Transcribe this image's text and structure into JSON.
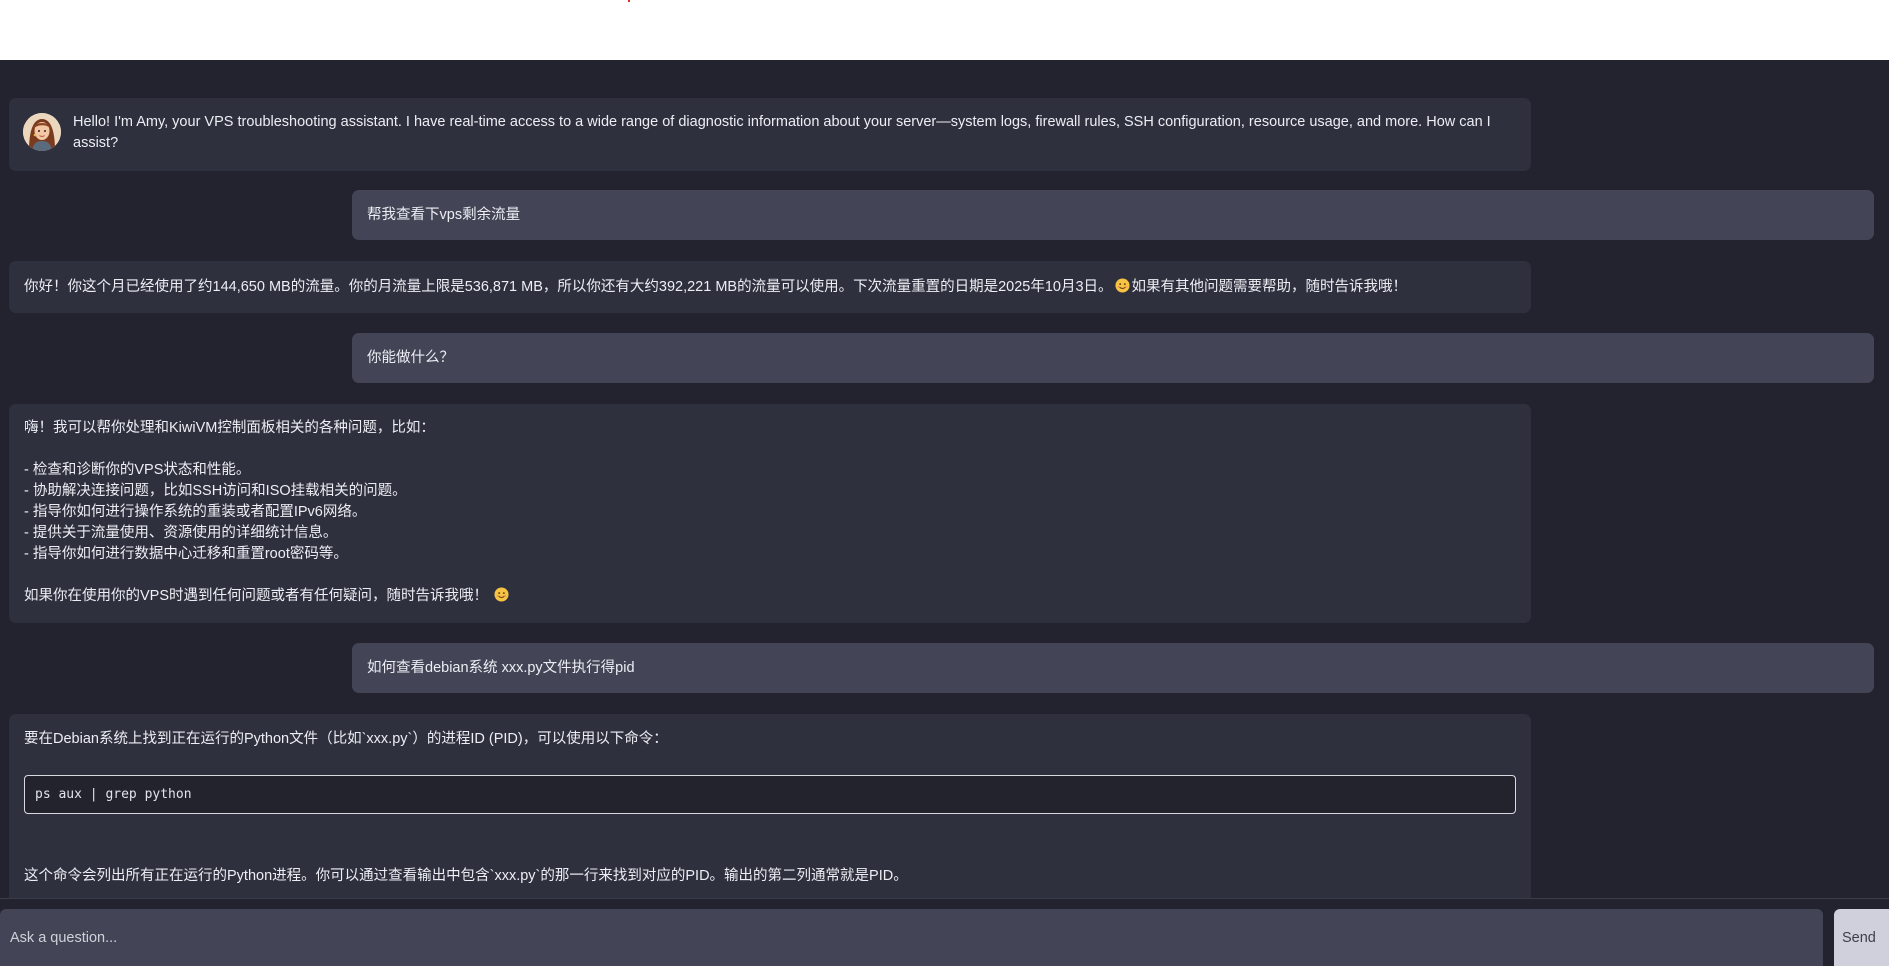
{
  "chat": {
    "assistant_greeting": "Hello! I'm Amy, your VPS troubleshooting assistant. I have real-time access to a wide range of diagnostic information about your server—system logs, firewall rules, SSH configuration, resource usage, and more. How can I assist?",
    "assistant_avatar_icon": "assistant-avatar-amy",
    "messages": [
      {
        "role": "user",
        "text": "帮我查看下vps剩余流量"
      },
      {
        "role": "assistant",
        "text": "你好！你这个月已经使用了约144,650 MB的流量。你的月流量上限是536,871 MB，所以你还有大约392,221 MB的流量可以使用。下次流量重置的日期是2025年10月3日。",
        "text_after_emoji": "如果有其他问题需要帮助，随时告诉我哦！"
      },
      {
        "role": "user",
        "text": "你能做什么？"
      },
      {
        "role": "assistant",
        "intro": "嗨！我可以帮你处理和KiwiVM控制面板相关的各种问题，比如：",
        "items": [
          "- 检查和诊断你的VPS状态和性能。",
          "- 协助解决连接问题，比如SSH访问和ISO挂载相关的问题。",
          "- 指导你如何进行操作系统的重装或者配置IPv6网络。",
          "- 提供关于流量使用、资源使用的详细统计信息。",
          "- 指导你如何进行数据中心迁移和重置root密码等。"
        ],
        "outro": "如果你在使用你的VPS时遇到任何问题或者有任何疑问，随时告诉我哦！"
      },
      {
        "role": "user",
        "text": "如何查看debian系统 xxx.py文件执行得pid"
      },
      {
        "role": "assistant",
        "intro": "要在Debian系统上找到正在运行的Python文件（比如`xxx.py`）的进程ID (PID)，可以使用以下命令：",
        "code": "ps aux | grep python",
        "outro": "这个命令会列出所有正在运行的Python进程。你可以通过查看输出中包含`xxx.py`的那一行来找到对应的PID。输出的第二列通常就是PID。"
      }
    ]
  },
  "composer": {
    "placeholder": "Ask a question...",
    "send_label": "Send"
  },
  "colors": {
    "background": "#22232f",
    "assistant_bubble": "#2f303e",
    "user_bubble": "#434556",
    "send_button": "#cfd0db"
  }
}
